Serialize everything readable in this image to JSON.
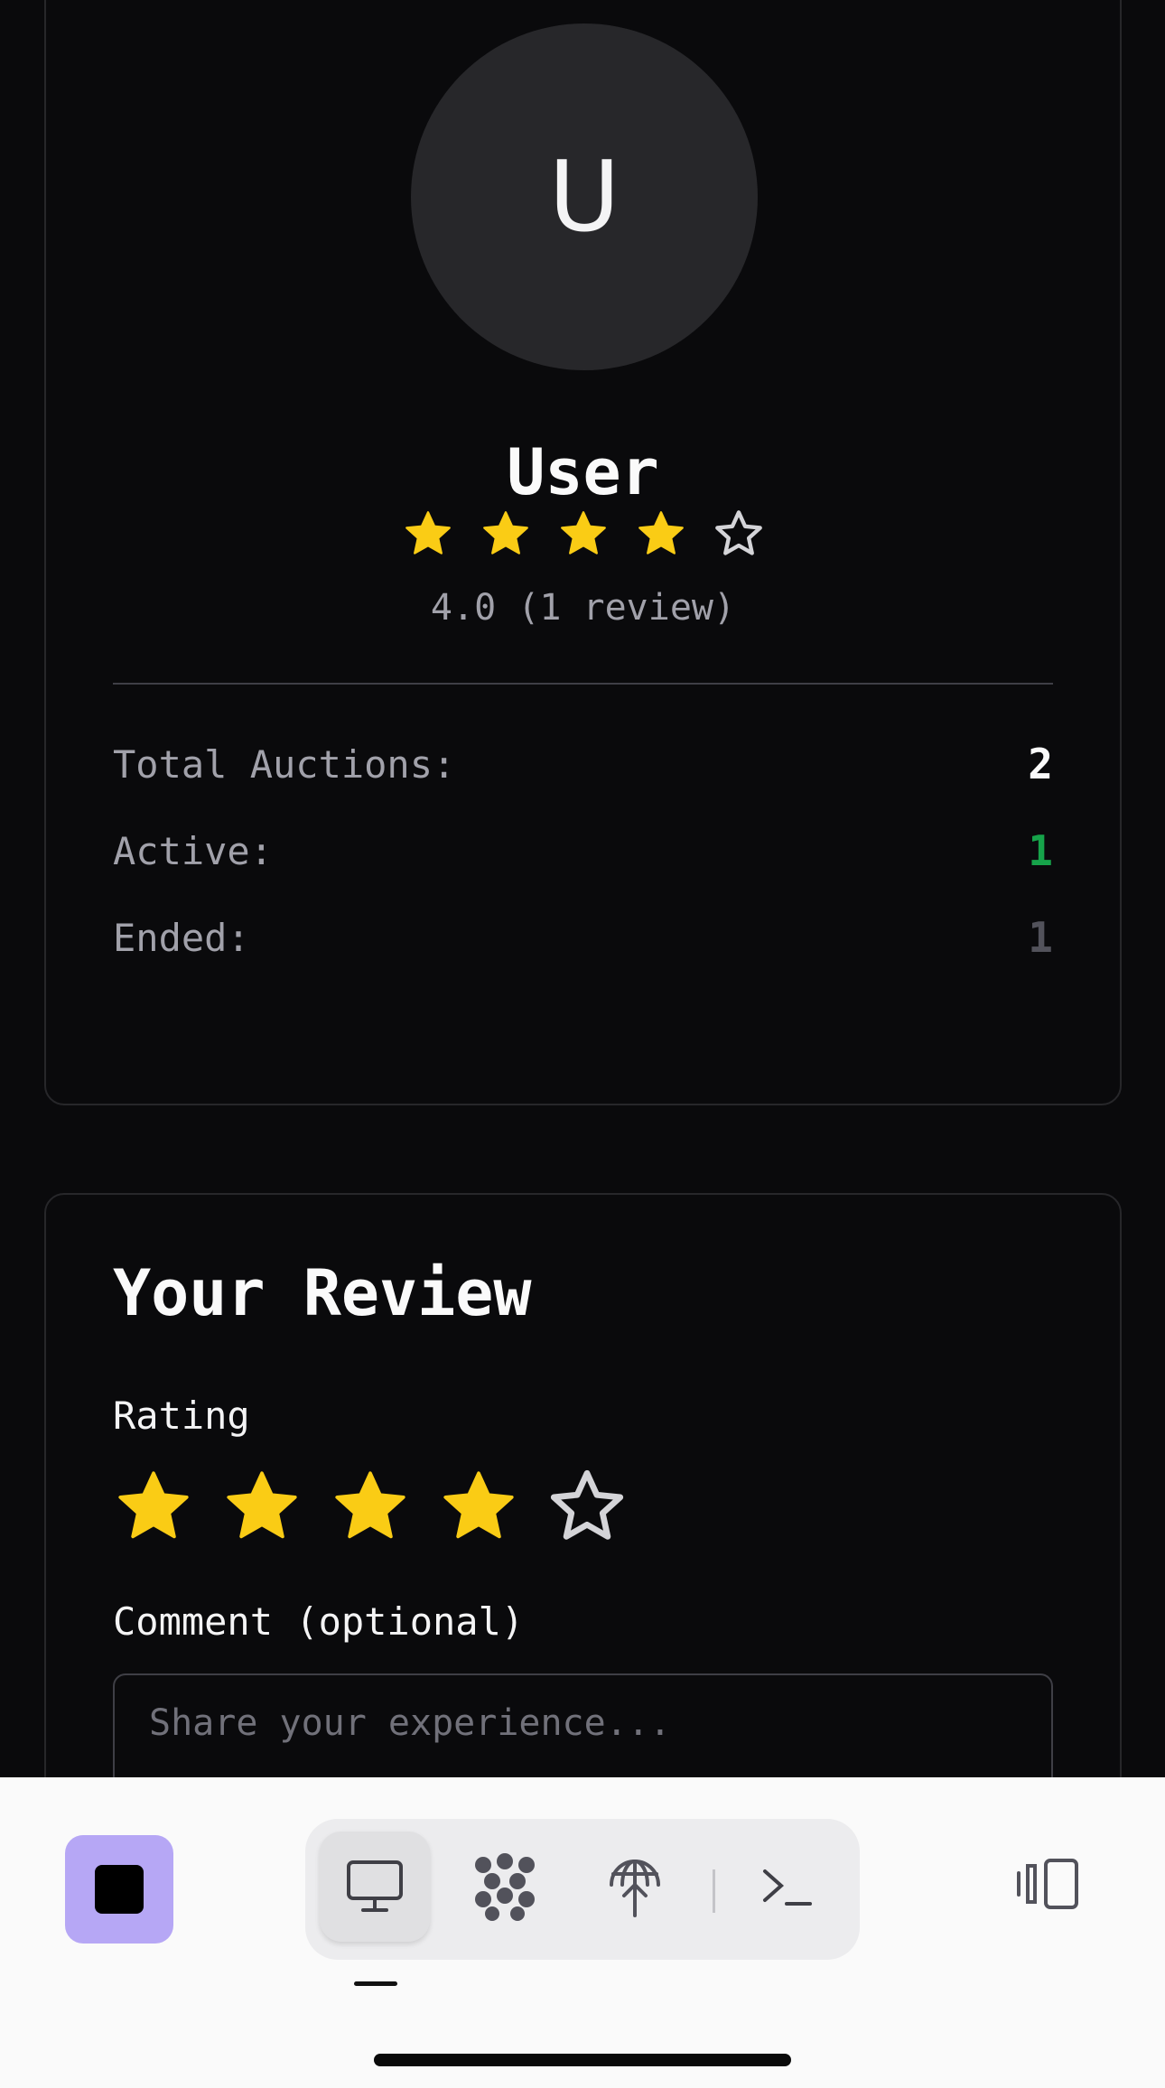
{
  "profile": {
    "avatar_initial": "U",
    "username": "User",
    "rating_stars": 4,
    "rating_max": 5,
    "rating_text": "4.0 (1 review)",
    "stats": [
      {
        "label": "Total Auctions:",
        "value": "2",
        "color": "#fafafa"
      },
      {
        "label": "Active:",
        "value": "1",
        "color": "#16a34a"
      },
      {
        "label": "Ended:",
        "value": "1",
        "color": "#52525b"
      }
    ]
  },
  "review": {
    "title": "Your Review",
    "rating_label": "Rating",
    "selected_rating": 4,
    "rating_max": 5,
    "comment_label": "Comment (optional)",
    "comment_placeholder": "Share your experience...",
    "comment_value": ""
  },
  "colors": {
    "star_filled": "#facc15",
    "star_empty_stroke": "#d4d4d8",
    "accent_square": "#b6a7f5"
  },
  "bottom_bar": {
    "icons": [
      "app-square-icon",
      "monitor-icon",
      "network-dots-icon",
      "globe-antenna-icon",
      "terminal-icon",
      "panel-toggle-icon"
    ],
    "active_tab": "monitor-icon"
  }
}
